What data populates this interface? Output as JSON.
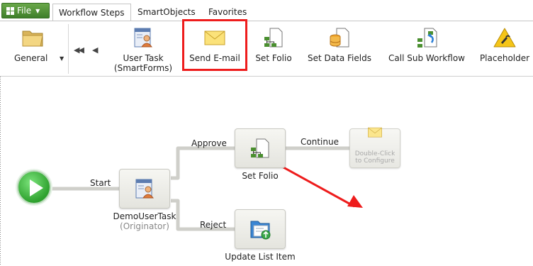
{
  "tabs": {
    "file": "File",
    "workflow_steps": "Workflow Steps",
    "smartobjects": "SmartObjects",
    "favorites": "Favorites"
  },
  "ribbon": {
    "general": "General",
    "user_task_line1": "User Task",
    "user_task_line2": "(SmartForms)",
    "send_email": "Send E-mail",
    "set_folio": "Set Folio",
    "set_data_fields": "Set Data Fields",
    "call_sub_workflow": "Call Sub Workflow",
    "placeholder": "Placeholder"
  },
  "workflow": {
    "start_label": "Start",
    "approve_label": "Approve",
    "continue_label": "Continue",
    "reject_label": "Reject",
    "user_task_name": "DemoUserTask",
    "user_task_role": "(Originator)",
    "set_folio_name": "Set Folio",
    "email_hint_line1": "Double-Click",
    "email_hint_line2": "to Configure",
    "update_list_name": "Update List Item"
  },
  "colors": {
    "highlight": "#ee1c1c",
    "start_green": "#2ea12e",
    "file_green": "#4f8f36"
  },
  "icons": [
    "folder-icon",
    "user-task-icon",
    "envelope-icon",
    "org-chart-icon",
    "data-fields-icon",
    "sub-workflow-icon",
    "placeholder-icon",
    "play-icon",
    "list-update-icon"
  ]
}
